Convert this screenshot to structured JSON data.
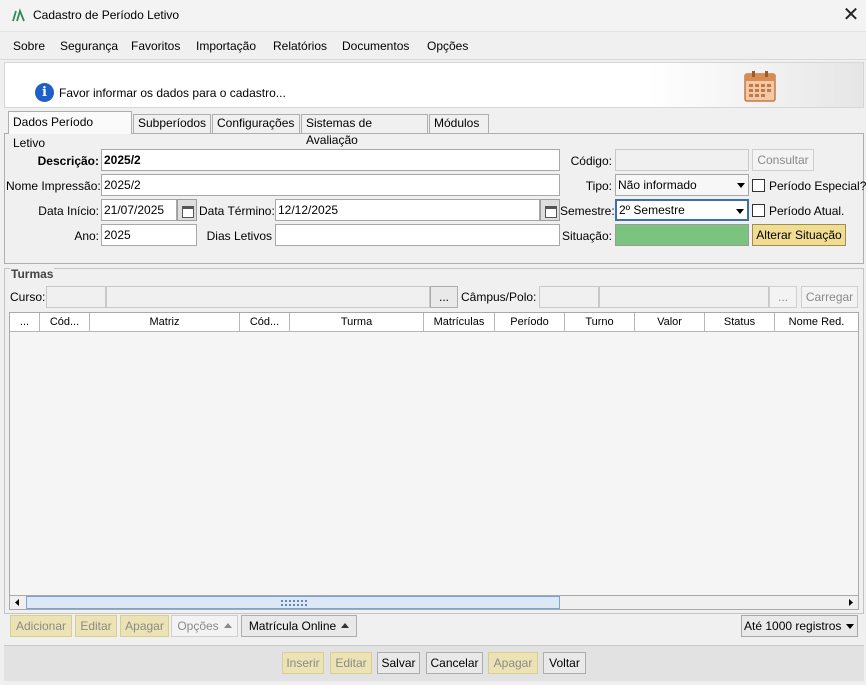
{
  "window": {
    "title": "Cadastro de Período Letivo",
    "close_glyph": "✕"
  },
  "menu": [
    "Sobre",
    "Segurança",
    "Favoritos",
    "Importação",
    "Relatórios",
    "Documentos",
    "Opções"
  ],
  "banner": {
    "text": "Favor informar os dados para o cadastro..."
  },
  "tabs": [
    "Dados Período Letivo",
    "Subperíodos",
    "Configurações",
    "Sistemas de Avaliação",
    "Módulos"
  ],
  "form": {
    "descricao_label": "Descrição:",
    "descricao_value": "2025/2",
    "nome_impressao_label": "Nome Impressão:",
    "nome_impressao_value": "2025/2",
    "data_inicio_label": "Data Início:",
    "data_inicio_value": "21/07/2025",
    "data_termino_label": "Data Término:",
    "data_termino_value": "12/12/2025",
    "ano_label": "Ano:",
    "ano_value": "2025",
    "dias_letivos_label": "Dias Letivos",
    "dias_letivos_value": "",
    "codigo_label": "Código:",
    "codigo_value": "",
    "consultar_label": "Consultar",
    "tipo_label": "Tipo:",
    "tipo_value": "Não informado",
    "periodo_especial_label": "Período Especial?",
    "semestre_label": "Semestre:",
    "semestre_value": "2º Semestre",
    "periodo_atual_label": "Período Atual.",
    "situacao_label": "Situação:",
    "situacao_color": "#7bc47f",
    "alterar_situacao_label": "Alterar Situação"
  },
  "turmas": {
    "title": "Turmas",
    "curso_label": "Curso:",
    "campus_label": "Câmpus/Polo:",
    "ellipsis": "...",
    "carregar_label": "Carregar",
    "columns": [
      "...",
      "Cód...",
      "Matriz",
      "Cód...",
      "Turma",
      "Matrículas",
      "Período",
      "Turno",
      "Valor",
      "Status",
      "Nome Red."
    ]
  },
  "grid_actions": {
    "adicionar": "Adicionar",
    "editar": "Editar",
    "apagar": "Apagar",
    "opcoes": "Opções",
    "matricula_online": "Matrícula Online",
    "registros": "Até 1000 registros"
  },
  "footer": {
    "inserir": "Inserir",
    "editar": "Editar",
    "salvar": "Salvar",
    "cancelar": "Cancelar",
    "apagar": "Apagar",
    "voltar": "Voltar"
  }
}
